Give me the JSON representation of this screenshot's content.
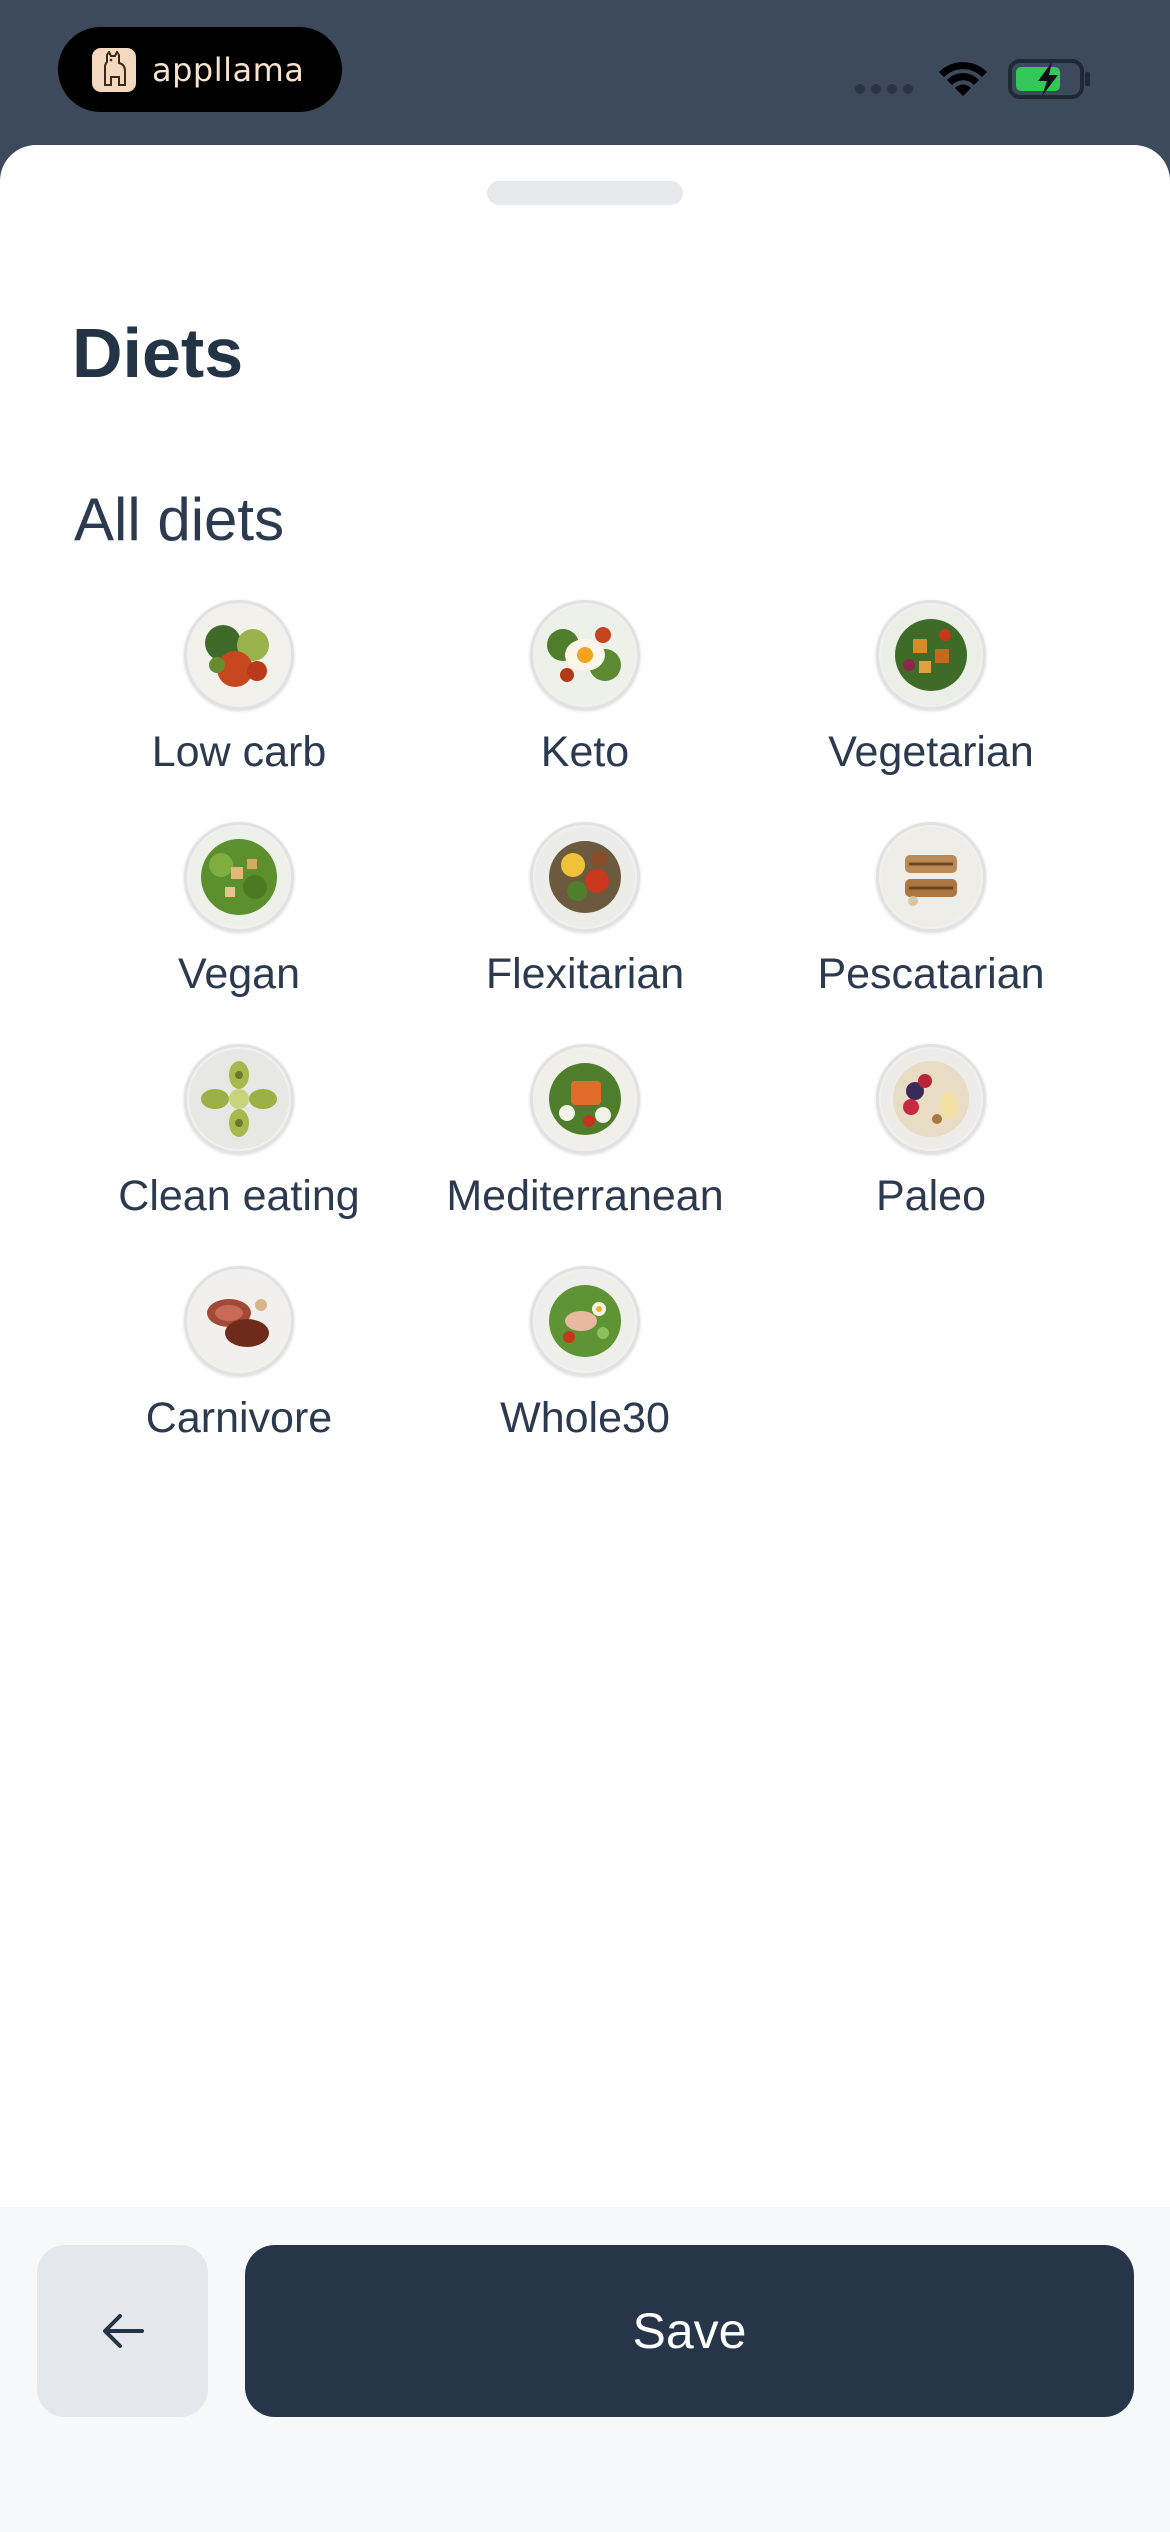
{
  "status_bar": {
    "brand_name": "appllama",
    "brand_icon": "llama-icon",
    "wifi_icon": "wifi-icon",
    "battery_icon": "battery-charging-icon",
    "battery_color": "#34c759"
  },
  "sheet": {
    "title": "Diets",
    "section_title": "All diets"
  },
  "diets": [
    {
      "label": "Low carb",
      "icon": "low-carb-dish-image"
    },
    {
      "label": "Keto",
      "icon": "keto-dish-image"
    },
    {
      "label": "Vegetarian",
      "icon": "vegetarian-dish-image"
    },
    {
      "label": "Vegan",
      "icon": "vegan-dish-image"
    },
    {
      "label": "Flexitarian",
      "icon": "flexitarian-dish-image"
    },
    {
      "label": "Pescatarian",
      "icon": "pescatarian-dish-image"
    },
    {
      "label": "Clean eating",
      "icon": "clean-eating-dish-image"
    },
    {
      "label": "Mediterranean",
      "icon": "mediterranean-dish-image"
    },
    {
      "label": "Paleo",
      "icon": "paleo-dish-image"
    },
    {
      "label": "Carnivore",
      "icon": "carnivore-dish-image"
    },
    {
      "label": "Whole30",
      "icon": "whole30-dish-image"
    }
  ],
  "footer": {
    "back_icon": "arrow-left-icon",
    "save_label": "Save"
  },
  "colors": {
    "header_bg": "#3d4a5c",
    "primary": "#263548",
    "text": "#2b3a4e"
  }
}
